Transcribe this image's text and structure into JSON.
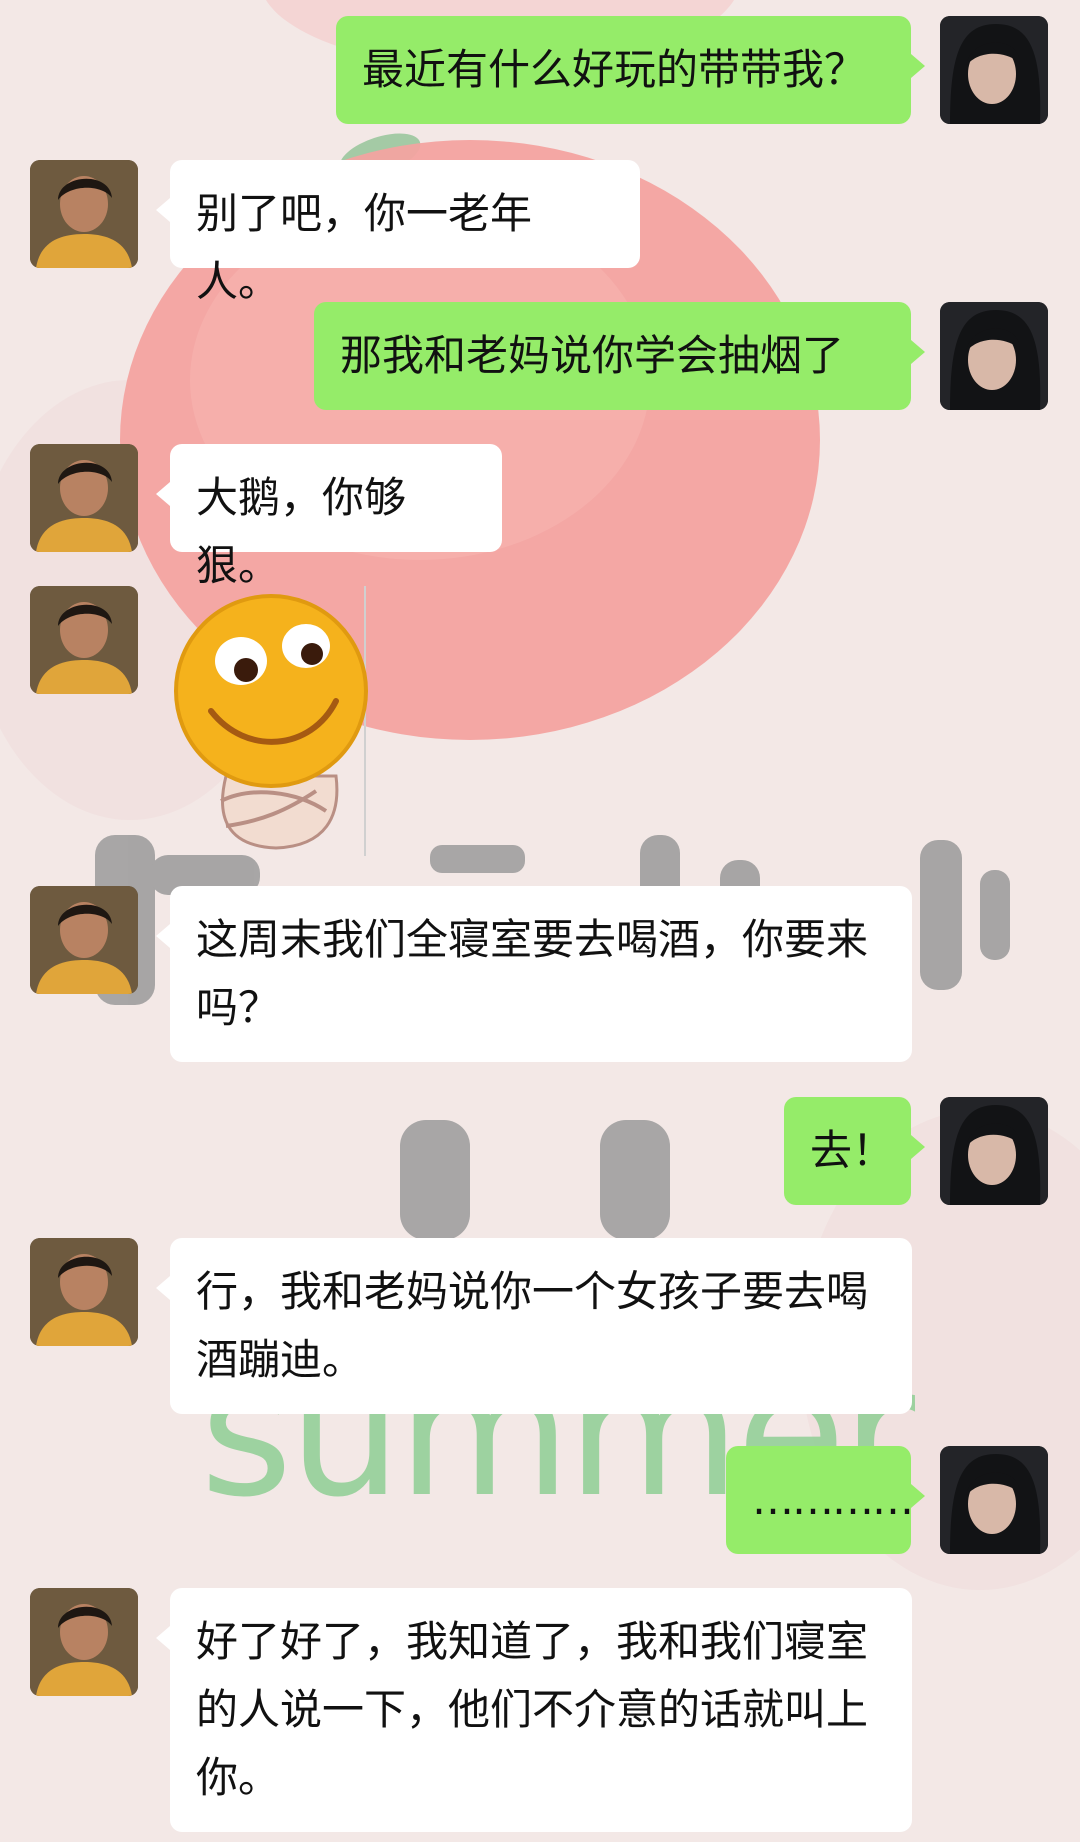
{
  "background": {
    "word": "summer",
    "kana_top": "ほ そ わ い",
    "kana_mid": "も も",
    "peach_color": "#f3a3a0",
    "leaf_color": "#9bc79d"
  },
  "participants": {
    "me": {
      "bubble_color": "#95ec69",
      "avatar_icon": "avatar-long-hair-icon"
    },
    "sister": {
      "bubble_color": "#ffffff",
      "avatar_icon": "avatar-short-hair-icon"
    }
  },
  "messages": [
    {
      "from": "me",
      "text": "最近有什么好玩的带带我？"
    },
    {
      "from": "sister",
      "text": "别了吧，你一老年人。"
    },
    {
      "from": "me",
      "text": "那我和老妈说你学会抽烟了"
    },
    {
      "from": "sister",
      "text": "大鹅，你够狠。"
    },
    {
      "from": "sister",
      "type": "sticker",
      "sticker": "smiley-crossed-arms-sticker"
    },
    {
      "from": "sister",
      "text": "这周末我们全寝室要去喝酒，你要来吗？"
    },
    {
      "from": "me",
      "text": "去！"
    },
    {
      "from": "sister",
      "text": "行，我和老妈说你一个女孩子要去喝酒蹦迪。"
    },
    {
      "from": "me",
      "text": "…………"
    },
    {
      "from": "sister",
      "text": "好了好了，我知道了，我和我们寝室的人说一下，他们不介意的话就叫上你。"
    }
  ]
}
